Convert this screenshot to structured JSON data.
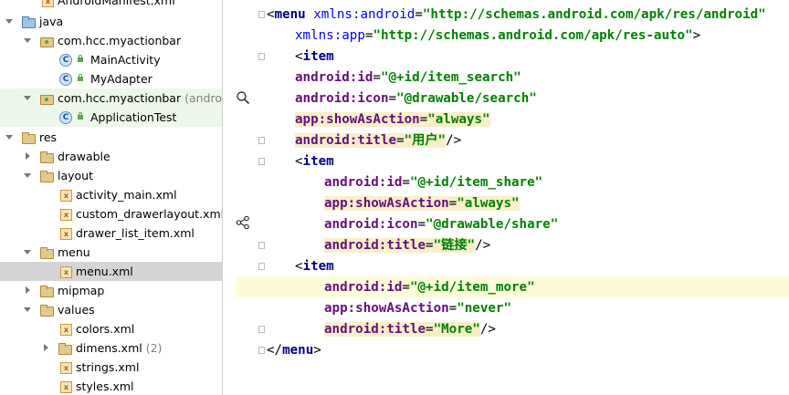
{
  "tree": {
    "items": [
      {
        "label": "AndroidManifest.xml",
        "hint": ""
      },
      {
        "label": "java",
        "hint": ""
      },
      {
        "label": "com.hcc.myactionbar",
        "hint": ""
      },
      {
        "label": "MainActivity",
        "hint": ""
      },
      {
        "label": "MyAdapter",
        "hint": ""
      },
      {
        "label": "com.hcc.myactionbar",
        "hint": "(androidT"
      },
      {
        "label": "ApplicationTest",
        "hint": ""
      },
      {
        "label": "res",
        "hint": ""
      },
      {
        "label": "drawable",
        "hint": ""
      },
      {
        "label": "layout",
        "hint": ""
      },
      {
        "label": "activity_main.xml",
        "hint": ""
      },
      {
        "label": "custom_drawerlayout.xml",
        "hint": ""
      },
      {
        "label": "drawer_list_item.xml",
        "hint": ""
      },
      {
        "label": "menu",
        "hint": ""
      },
      {
        "label": "menu.xml",
        "hint": ""
      },
      {
        "label": "mipmap",
        "hint": ""
      },
      {
        "label": "values",
        "hint": ""
      },
      {
        "label": "colors.xml",
        "hint": ""
      },
      {
        "label": "dimens.xml",
        "hint": "(2)"
      },
      {
        "label": "strings.xml",
        "hint": ""
      },
      {
        "label": "styles.xml",
        "hint": ""
      }
    ]
  },
  "icons": {
    "class_letter": "C",
    "xml_letter": "x"
  },
  "editor": {
    "lines": [
      {
        "tok": [
          "<",
          "menu",
          " ",
          "xmlns:android",
          "=",
          "\"http://schemas.android.com/apk/res/android\""
        ]
      },
      {
        "tok": [
          "xmlns:app",
          "=",
          "\"http://schemas.android.com/apk/res-auto\"",
          ">"
        ]
      },
      {
        "tok": [
          "<",
          "item"
        ]
      },
      {
        "tok": [
          "android:id",
          "=",
          "\"@+id/item_search\""
        ]
      },
      {
        "tok": [
          "android:icon",
          "=",
          "\"@drawable/search\""
        ]
      },
      {
        "tok": [
          "app:showAsAction",
          "=",
          "\"always\""
        ]
      },
      {
        "tok": [
          "android:title",
          "=",
          "\"用户\"",
          "/>"
        ]
      },
      {
        "tok": [
          "<",
          "item"
        ]
      },
      {
        "tok": [
          "android:id",
          "=",
          "\"@+id/item_share\""
        ]
      },
      {
        "tok": [
          "app:showAsAction",
          "=",
          "\"always\""
        ]
      },
      {
        "tok": [
          "android:icon",
          "=",
          "\"@drawable/share\""
        ]
      },
      {
        "tok": [
          "android:title",
          "=",
          "\"链接\"",
          "/>"
        ]
      },
      {
        "tok": [
          "<",
          "item"
        ]
      },
      {
        "tok": [
          "android:id",
          "=",
          "\"@+id/item_more\""
        ]
      },
      {
        "tok": [
          "app:showAsAction",
          "=",
          "\"never\""
        ]
      },
      {
        "tok": [
          "android:title",
          "=",
          "\"More\"",
          "/>"
        ]
      },
      {
        "tok": [
          "</",
          "menu",
          ">"
        ]
      }
    ]
  },
  "colors": {
    "tag": "#000080",
    "namespace_attr": "#660e7a",
    "attr_value": "#008000",
    "selected_row": "#d5d5d5",
    "test_package_row": "#edf7ea"
  }
}
